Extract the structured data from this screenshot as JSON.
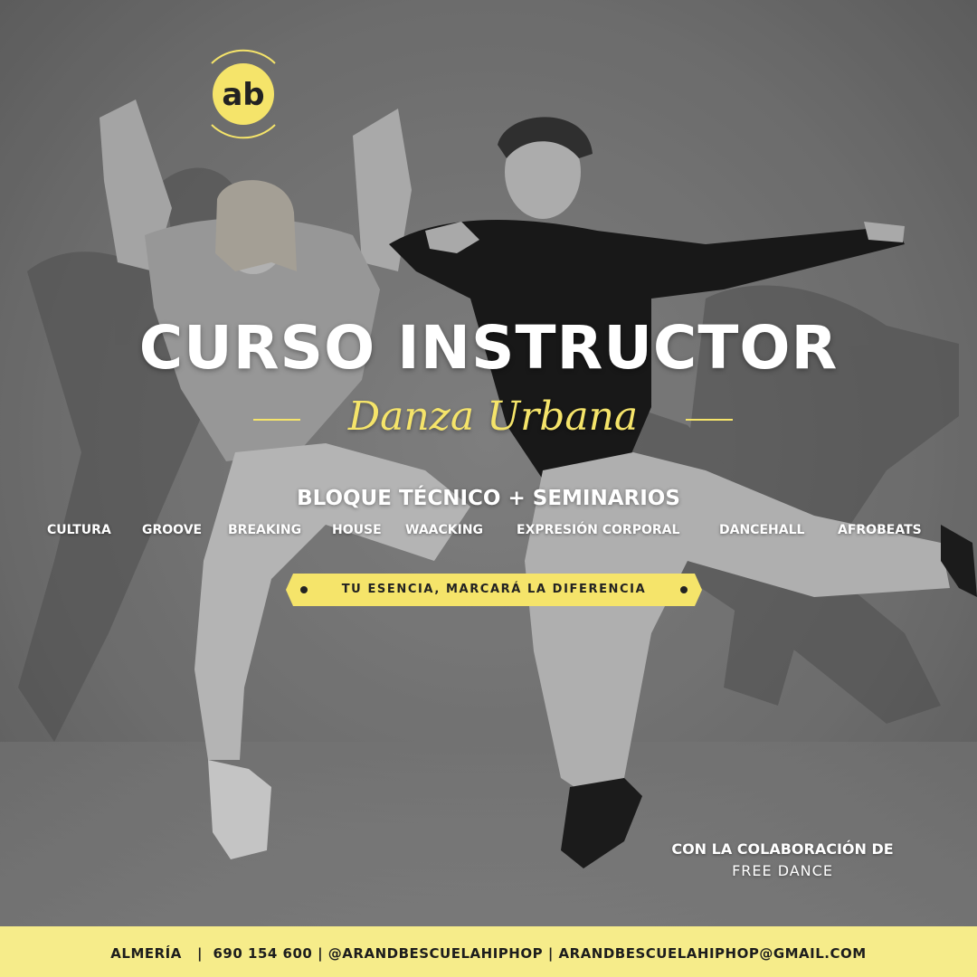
{
  "logo": {
    "text": "ab",
    "icon": "ab-logo-icon"
  },
  "title": "CURSO INSTRUCTOR",
  "subtitle": "Danza Urbana",
  "block_title": "BLOQUE TÉCNICO + SEMINARIOS",
  "topics": [
    "CULTURA",
    "GROOVE",
    "BREAKING",
    "HOUSE",
    "WAACKING",
    "EXPRESIÓN CORPORAL",
    "DANCEHALL",
    "AFROBEATS"
  ],
  "tagline": "TU ESENCIA, MARCARÁ LA DIFERENCIA",
  "collab": {
    "line1": "CON LA COLABORACIÓN DE",
    "line2": "FREE DANCE"
  },
  "footer": {
    "city": "ALMERÍA",
    "phone": "690 154 600",
    "instagram": "@ARANDBESCUELAHIPHOP",
    "email": "ARANDBESCUELAHIPHOP@GMAIL.COM"
  },
  "colors": {
    "accent": "#f5e46a",
    "footer_bg": "#f6ec8a",
    "text": "#ffffff"
  }
}
